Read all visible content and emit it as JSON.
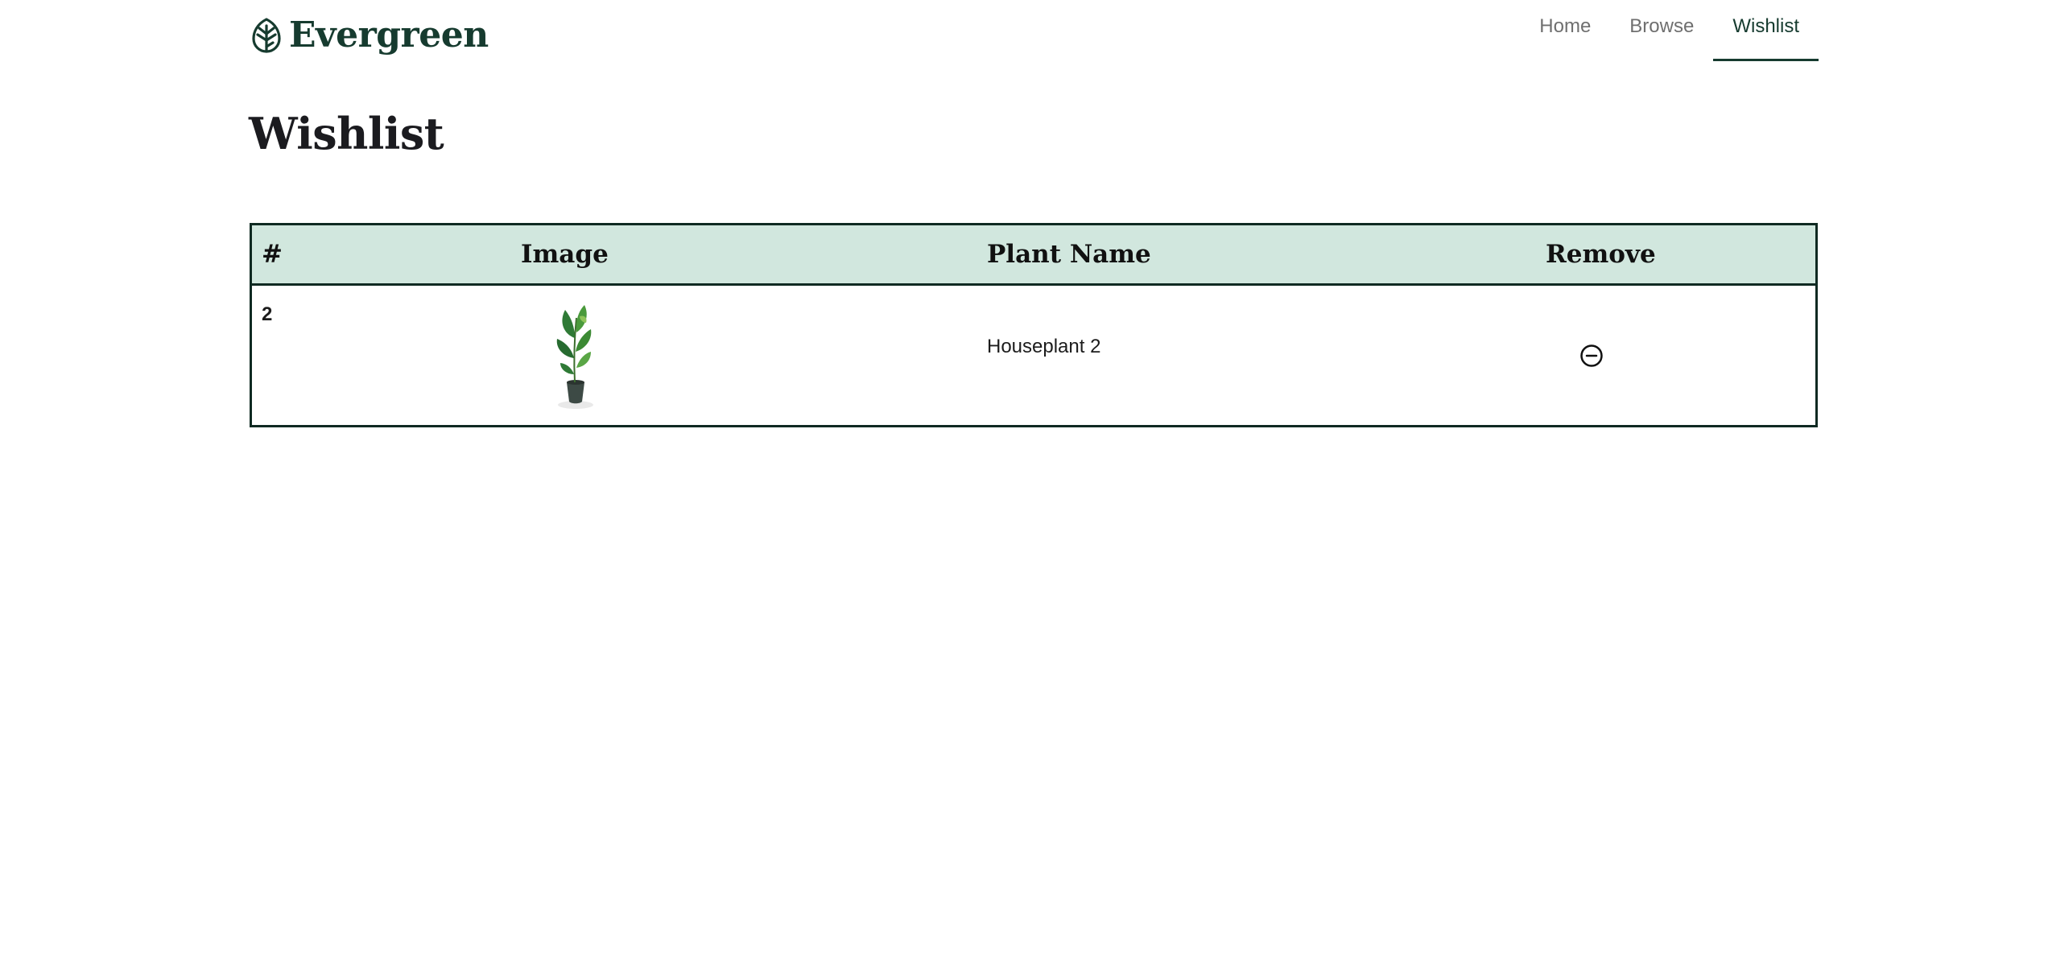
{
  "brand": {
    "name": "Evergreen",
    "icon": "leaf-icon",
    "color": "#163b2f"
  },
  "nav": {
    "items": [
      {
        "label": "Home",
        "active": false
      },
      {
        "label": "Browse",
        "active": false
      },
      {
        "label": "Wishlist",
        "active": true
      }
    ]
  },
  "page": {
    "title": "Wishlist"
  },
  "table": {
    "headers": [
      "#",
      "Image",
      "Plant Name",
      "Remove"
    ],
    "header_bg": "#d1e7de",
    "rows": [
      {
        "number": "2",
        "image_icon": "houseplant-image",
        "name": "Houseplant 2",
        "remove_icon": "minus-circle-icon"
      }
    ]
  }
}
